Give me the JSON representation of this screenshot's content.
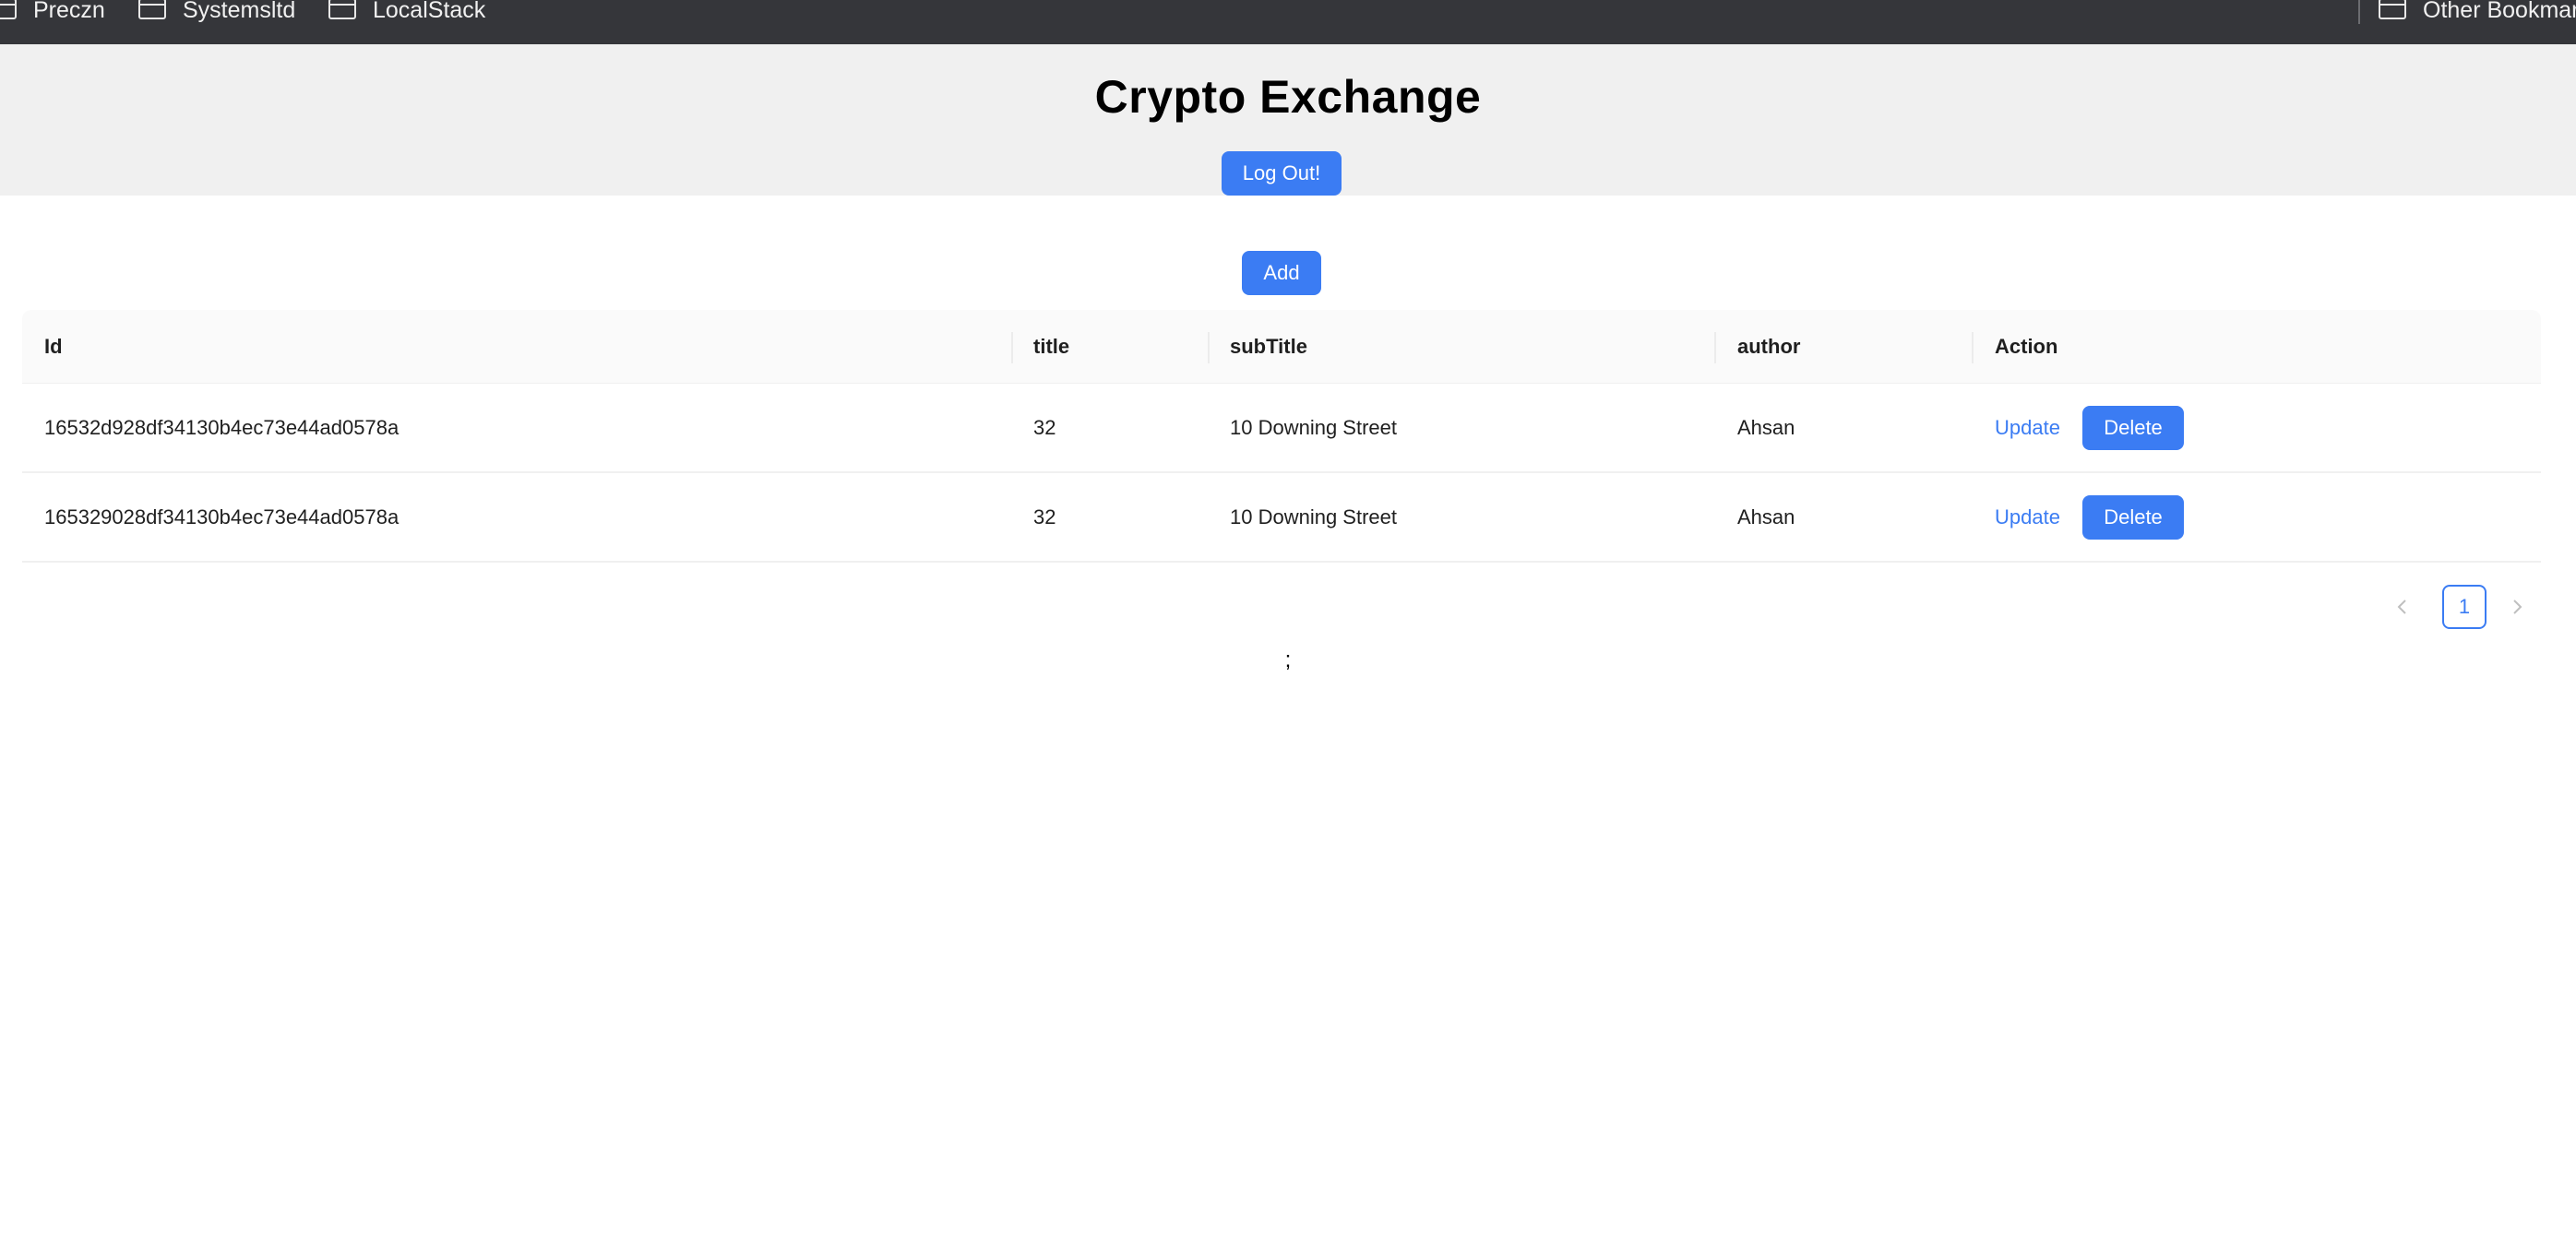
{
  "bookmarks": {
    "items": [
      {
        "label": "Preczn",
        "icon": "folder-icon"
      },
      {
        "label": "Systemsltd",
        "icon": "folder-icon"
      },
      {
        "label": "LocalStack",
        "icon": "folder-icon"
      }
    ],
    "other_label": "Other Bookmarks"
  },
  "header": {
    "title": "Crypto Exchange",
    "logout_label": "Log Out!"
  },
  "toolbar": {
    "add_label": "Add"
  },
  "table": {
    "columns": [
      "Id",
      "title",
      "subTitle",
      "author",
      "Action"
    ],
    "rows": [
      {
        "id": "16532d928df34130b4ec73e44ad0578a",
        "title": "32",
        "subTitle": "10 Downing Street",
        "author": "Ahsan",
        "update_label": "Update",
        "delete_label": "Delete"
      },
      {
        "id": "165329028df34130b4ec73e44ad0578a",
        "title": "32",
        "subTitle": "10 Downing Street",
        "author": "Ahsan",
        "update_label": "Update",
        "delete_label": "Delete"
      }
    ]
  },
  "pagination": {
    "prev_icon": "chevron-left-icon",
    "current_page": "1",
    "next_icon": "chevron-right-icon"
  },
  "footer_text": ";",
  "colors": {
    "primary": "#3b7cf3",
    "header_bg": "#f0f0f0",
    "bookmarks_bg": "#35363a"
  }
}
